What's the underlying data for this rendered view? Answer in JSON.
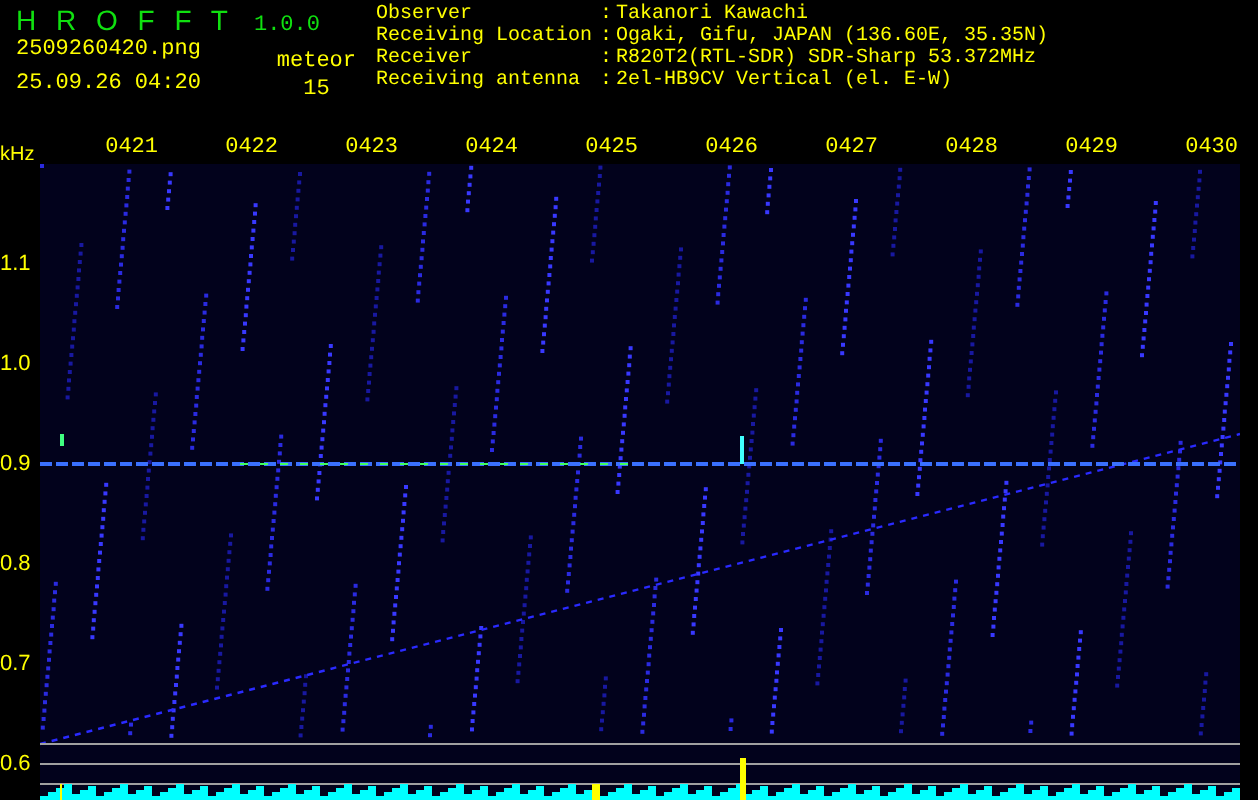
{
  "app": {
    "title": "H R O F F T",
    "version": "1.0.0"
  },
  "file": {
    "name": "2509260420.png",
    "datetime": "25.09.26 04:20"
  },
  "meteor": {
    "label": "meteor",
    "count": "15"
  },
  "info": [
    {
      "label": "Observer",
      "separator": ":",
      "value": "Takanori Kawachi"
    },
    {
      "label": "Receiving Location",
      "separator": ":",
      "value": "Ogaki, Gifu, JAPAN (136.60E, 35.35N)"
    },
    {
      "label": "Receiver",
      "separator": ":",
      "value": "R820T2(RTL-SDR) SDR-Sharp 53.372MHz"
    },
    {
      "label": "Receiving antenna",
      "separator": ":",
      "value": "2el-HB9CV Vertical (el. E-W)"
    }
  ],
  "axis": {
    "unit": "kHz",
    "times": [
      "0421",
      "0422",
      "0423",
      "0424",
      "0425",
      "0426",
      "0427",
      "0428",
      "0429",
      "0430"
    ],
    "frequencies": [
      "1.1",
      "1.0",
      "0.9",
      "0.8",
      "0.7",
      "0.6"
    ]
  }
}
